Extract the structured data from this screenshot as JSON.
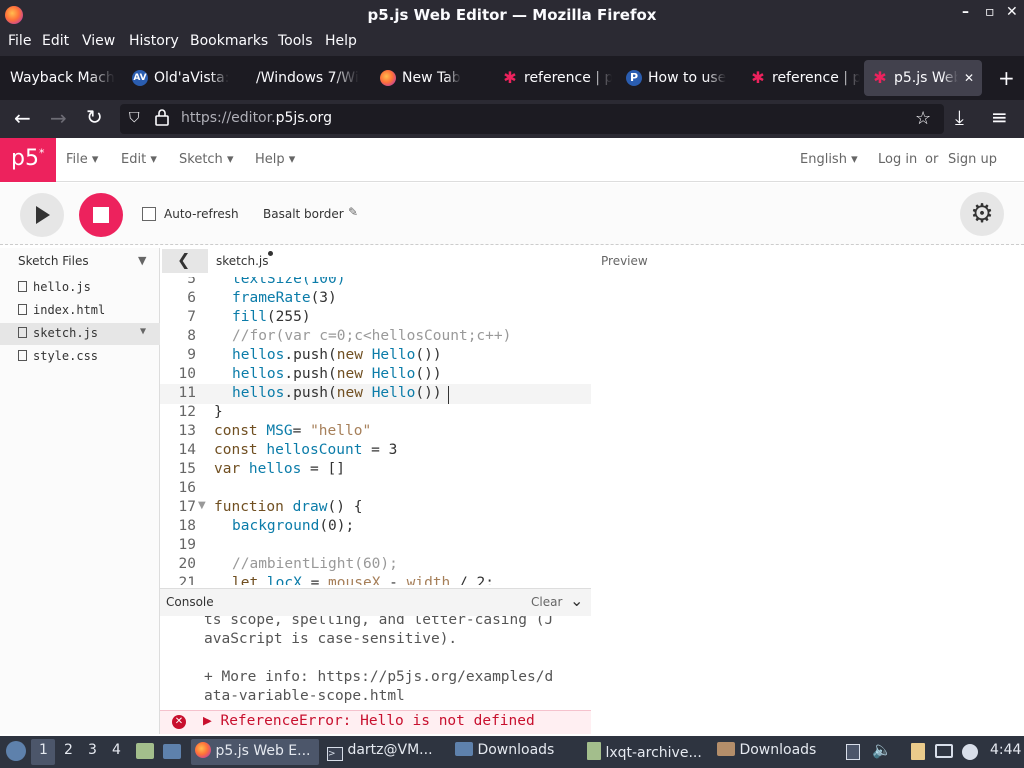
{
  "window": {
    "title": "p5.js Web Editor — Mozilla Firefox",
    "minimize": "–",
    "restore": "▫",
    "close": "✕"
  },
  "menubar": [
    "File",
    "Edit",
    "View",
    "History",
    "Bookmarks",
    "Tools",
    "Help"
  ],
  "tabs": [
    {
      "label": "Wayback Mach",
      "icon": ""
    },
    {
      "label": "Old'aVista:",
      "icon": "AV"
    },
    {
      "label": "/Windows 7/Wi",
      "icon": ""
    },
    {
      "label": "New Tab",
      "icon": "firefox"
    },
    {
      "label": "reference | p",
      "icon": "p5-star"
    },
    {
      "label": "How to use",
      "icon": "P"
    },
    {
      "label": "reference | p",
      "icon": "p5-star"
    },
    {
      "label": "p5.js Web",
      "icon": "p5-star",
      "close": "✕"
    }
  ],
  "url": {
    "prefix": "https://editor.",
    "domain": "p5js.org"
  },
  "p5": {
    "logo": "p5",
    "logo_sup": "*",
    "menu": [
      "File",
      "Edit",
      "Sketch",
      "Help"
    ],
    "language": "English",
    "login": "Log in",
    "or": "or",
    "signup": "Sign up",
    "autorefresh": "Auto-refresh",
    "sketch_name": "Basalt border",
    "sidebar_title": "Sketch Files",
    "files": [
      "hello.js",
      "index.html",
      "sketch.js",
      "style.css"
    ],
    "editor_tab": "sketch.js",
    "preview_label": "Preview",
    "console_label": "Console",
    "clear_label": "Clear"
  },
  "code": {
    "line_numbers": [
      "5",
      "6",
      "7",
      "8",
      "9",
      "10",
      "11",
      "12",
      "13",
      "14",
      "15",
      "16",
      "17",
      "18",
      "19",
      "20",
      "21"
    ],
    "l5": "textSize(100)",
    "l6a": "frameRate",
    "l6b": "(3)",
    "l7a": "fill",
    "l7b": "(255)",
    "l8": "//for(var c=0;c<hellosCount;c++)",
    "l9a": "hellos",
    "l9b": ".push(",
    "l9c": "new ",
    "l9d": "Hello",
    "l9e": "())",
    "l10a": "hellos",
    "l10b": ".push(",
    "l10c": "new ",
    "l10d": "Hello",
    "l10e": "())",
    "l11a": "hellos",
    "l11b": ".push(",
    "l11c": "new ",
    "l11d": "Hello",
    "l11e": "())",
    "l12": "}",
    "l13a": "const ",
    "l13b": "MSG",
    "l13c": "= ",
    "l13d": "\"hello\"",
    "l14a": "const ",
    "l14b": "hellosCount",
    "l14c": " = 3",
    "l15a": "var ",
    "l15b": "hellos",
    "l15c": " = []",
    "l17a": "function ",
    "l17b": "draw",
    "l17c": "() {",
    "l18a": "background",
    "l18b": "(0);",
    "l20": "//ambientLight(60);",
    "l21a": "let ",
    "l21b": "locX",
    "l21c": " = ",
    "l21d": "mouseX",
    "l21e": " - ",
    "l21f": "width",
    "l21g": " / 2;"
  },
  "console": {
    "line1": "ts scope, spelling, and letter-casing (J",
    "line2": "avaScript is case-sensitive).",
    "line3": "+ More info: https://p5js.org/examples/d",
    "line4": "ata-variable-scope.html",
    "error": "▶ ReferenceError: Hello is not defined"
  },
  "taskbar": {
    "workspaces": [
      "1",
      "2",
      "3",
      "4"
    ],
    "items": [
      {
        "label": "p5.js Web E...",
        "icon": "firefox"
      },
      {
        "label": "dartz@VM...",
        "icon": "terminal"
      },
      {
        "label": "Downloads",
        "icon": "folder"
      },
      {
        "label": "lxqt-archive...",
        "icon": "archive"
      },
      {
        "label": "Downloads",
        "icon": "folder"
      }
    ],
    "clock": "4:44"
  },
  "colors": {
    "p5_pink": "#ed225d",
    "firefox_dark": "#2b2a33",
    "taskbar": "#2e3440"
  }
}
